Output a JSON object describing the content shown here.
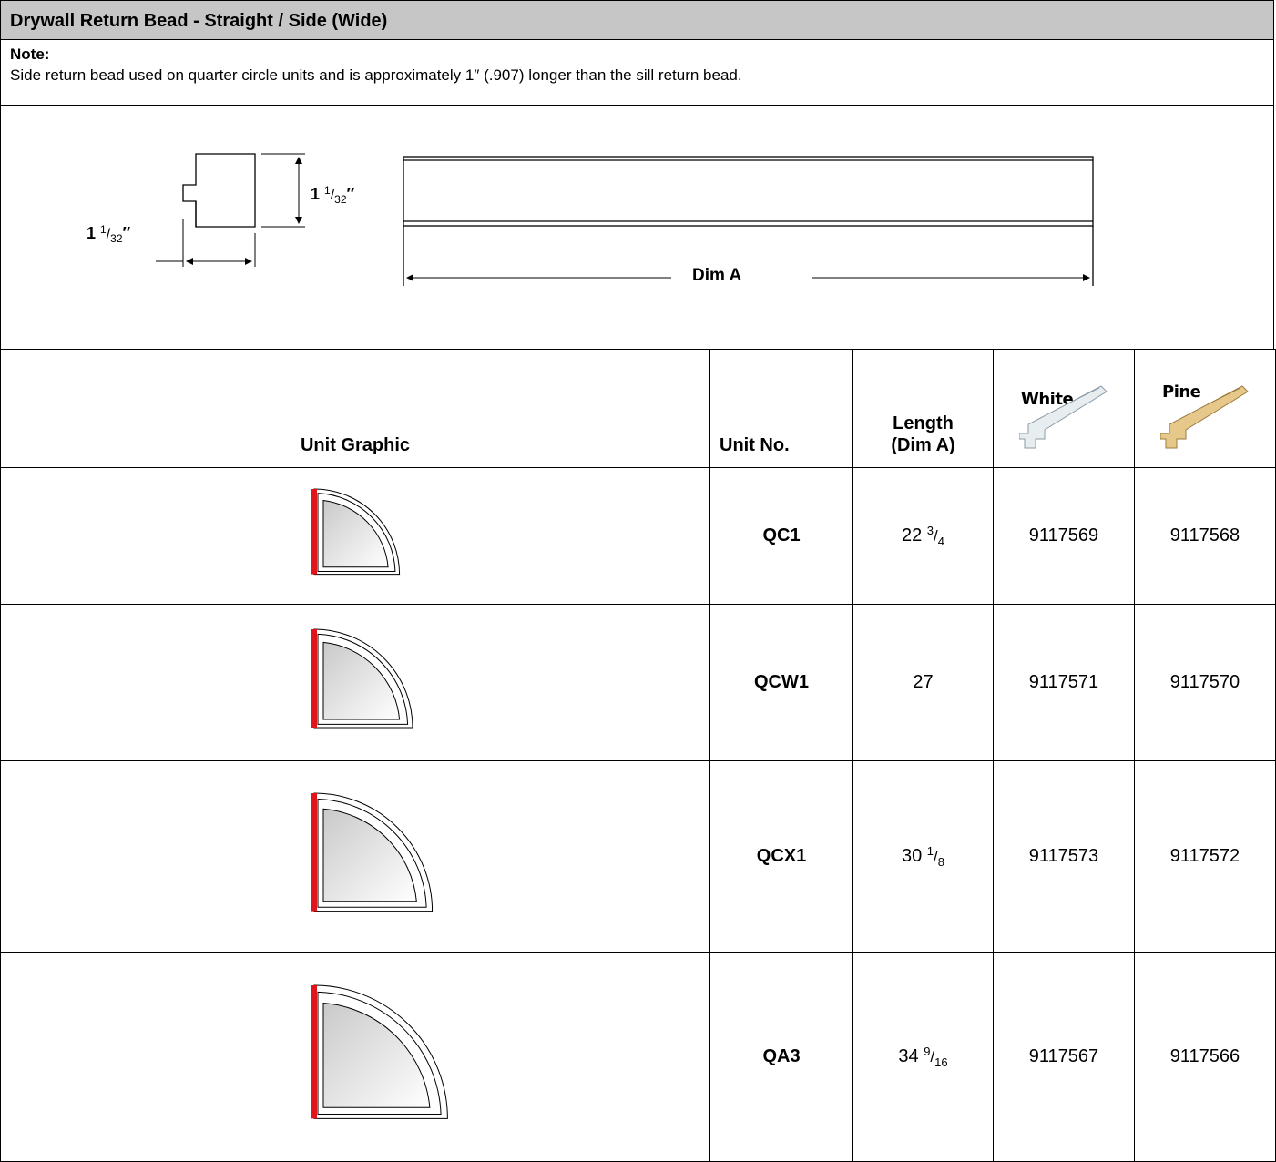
{
  "header": {
    "title": "Drywall Return Bead - Straight / Side (Wide)"
  },
  "note": {
    "label": "Note:",
    "text": "Side return bead used on quarter circle units and is approximately 1″ (.907) longer than the sill return bead."
  },
  "diagram": {
    "height_dim": {
      "whole": "1",
      "num": "1",
      "den": "32",
      "unit": "″"
    },
    "width_dim": {
      "whole": "1",
      "num": "1",
      "den": "32",
      "unit": "″"
    },
    "length_label": "Dim A"
  },
  "table": {
    "headers": {
      "graphic": "Unit Graphic",
      "unit_no": "Unit No.",
      "length_line1": "Length",
      "length_line2": "(Dim A)",
      "white": "White",
      "pine": "Pine"
    },
    "colors": {
      "white_swatch": "#e8edf0",
      "pine_swatch": "#e6c98a",
      "highlight": "#e1141b"
    },
    "rows": [
      {
        "unit": "QC1",
        "len_whole": "22",
        "len_num": "3",
        "len_den": "4",
        "white": "9117569",
        "pine": "9117568"
      },
      {
        "unit": "QCW1",
        "len_whole": "27",
        "len_num": "",
        "len_den": "",
        "white": "9117571",
        "pine": "9117570"
      },
      {
        "unit": "QCX1",
        "len_whole": "30",
        "len_num": "1",
        "len_den": "8",
        "white": "9117573",
        "pine": "9117572"
      },
      {
        "unit": "QA3",
        "len_whole": "34",
        "len_num": "9",
        "len_den": "16",
        "white": "9117567",
        "pine": "9117566"
      }
    ]
  }
}
